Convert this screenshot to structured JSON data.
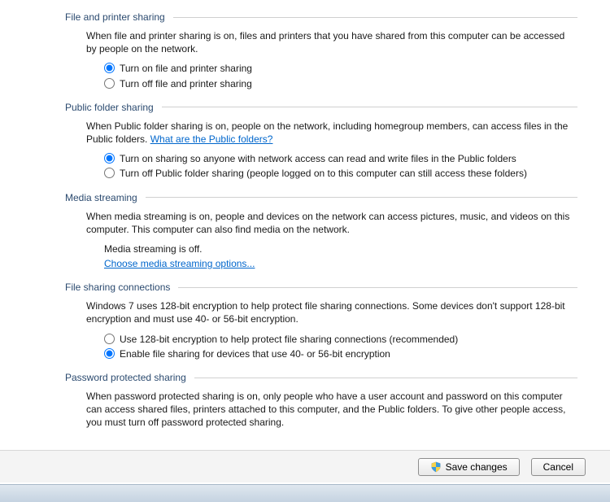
{
  "sections": {
    "file_printer": {
      "title": "File and printer sharing",
      "desc": "When file and printer sharing is on, files and printers that you have shared from this computer can be accessed by people on the network.",
      "opt_on": "Turn on file and printer sharing",
      "opt_off": "Turn off file and printer sharing"
    },
    "public_folder": {
      "title": "Public folder sharing",
      "desc_prefix": "When Public folder sharing is on, people on the network, including homegroup members, can access files in the Public folders. ",
      "link": "What are the Public folders?",
      "opt_on": "Turn on sharing so anyone with network access can read and write files in the Public folders",
      "opt_off": "Turn off Public folder sharing (people logged on to this computer can still access these folders)"
    },
    "media_streaming": {
      "title": "Media streaming",
      "desc": "When media streaming is on, people and devices on the network can access pictures, music, and videos on this computer. This computer can also find media on the network.",
      "status": "Media streaming is off.",
      "link": "Choose media streaming options..."
    },
    "file_sharing_conn": {
      "title": "File sharing connections",
      "desc": "Windows 7 uses 128-bit encryption to help protect file sharing connections. Some devices don't support 128-bit encryption and must use 40- or 56-bit encryption.",
      "opt_128": "Use 128-bit encryption to help protect file sharing connections (recommended)",
      "opt_4056": "Enable file sharing for devices that use 40- or 56-bit encryption"
    },
    "password_protected": {
      "title": "Password protected sharing",
      "desc": "When password protected sharing is on, only people who have a user account and password on this computer can access shared files, printers attached to this computer, and the Public folders. To give other people access, you must turn off password protected sharing."
    }
  },
  "buttons": {
    "save": "Save changes",
    "cancel": "Cancel"
  }
}
